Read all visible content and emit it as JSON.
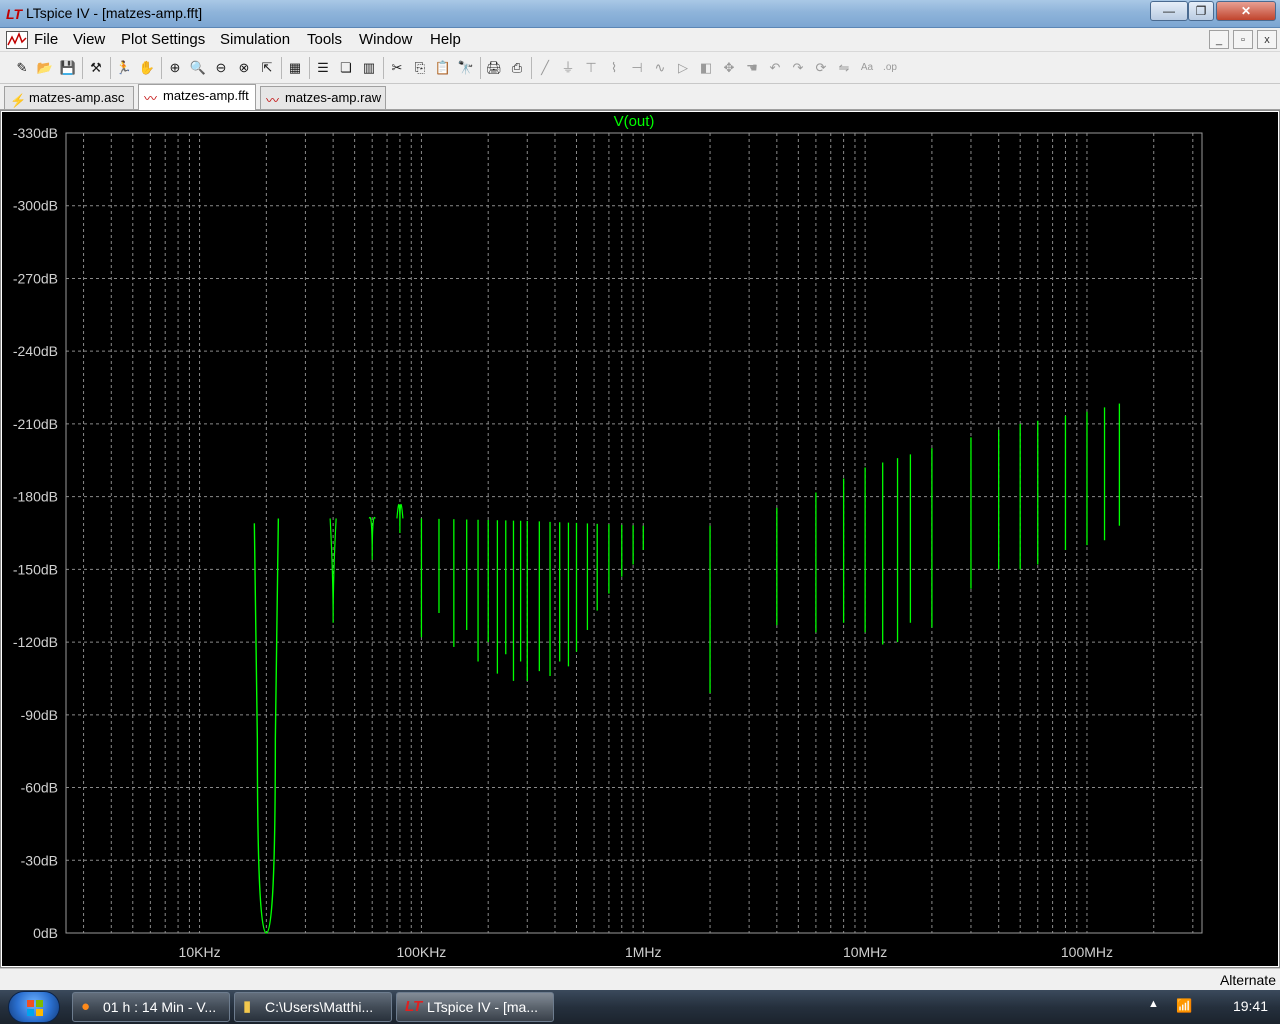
{
  "window": {
    "title": "LTspice IV - [matzes-amp.fft]",
    "logo_text": "LT",
    "minimize_glyph": "—",
    "maximize_glyph": "❐",
    "close_glyph": "✕"
  },
  "menu": {
    "items": [
      {
        "label": "File"
      },
      {
        "label": "View"
      },
      {
        "label": "Plot Settings"
      },
      {
        "label": "Simulation"
      },
      {
        "label": "Tools"
      },
      {
        "label": "Window"
      },
      {
        "label": "Help"
      }
    ],
    "mdi_minimize": "_",
    "mdi_restore": "▫",
    "mdi_close": "x"
  },
  "toolbar": {
    "icons": [
      "new-schematic-icon",
      "open-icon",
      "save-icon",
      "control-panel-icon",
      "run-icon",
      "pan-icon",
      "zoom-in-icon",
      "zoom-area-icon",
      "zoom-out-icon",
      "zoom-cancel-icon",
      "autorange-icon",
      "plot-settings-icon",
      "tile-horizontal-icon",
      "cascade-icon",
      "tile-vertical-icon",
      "cut-icon",
      "copy-icon",
      "paste-icon",
      "find-icon",
      "print-preview-icon",
      "print-icon",
      "wire-icon",
      "ground-icon",
      "label-icon",
      "resistor-icon",
      "capacitor-icon",
      "inductor-icon",
      "diode-icon",
      "component-icon",
      "move-icon",
      "drag-icon",
      "undo-icon",
      "redo-icon",
      "rotate-icon",
      "mirror-icon",
      "text-icon",
      "spice-directive-icon"
    ]
  },
  "tabs": [
    {
      "label": "matzes-amp.asc",
      "icon": "schematic-icon"
    },
    {
      "label": "matzes-amp.fft",
      "icon": "waveform-icon"
    },
    {
      "label": "matzes-amp.raw",
      "icon": "waveform-icon"
    }
  ],
  "chart_data": {
    "type": "line",
    "title": "V(out)",
    "trace_color": "#00ff00",
    "background_color": "#000000",
    "grid": true,
    "x_scale": "log",
    "xlim_hz": [
      2500,
      330000000
    ],
    "ylim_db": [
      -330,
      0
    ],
    "x_ticks": [
      {
        "value": 10000,
        "label": "10KHz"
      },
      {
        "value": 100000,
        "label": "100KHz"
      },
      {
        "value": 1000000,
        "label": "1MHz"
      },
      {
        "value": 10000000,
        "label": "10MHz"
      },
      {
        "value": 100000000,
        "label": "100MHz"
      }
    ],
    "y_ticks": [
      {
        "value": 0,
        "label": "0dB"
      },
      {
        "value": -30,
        "label": "-30dB"
      },
      {
        "value": -60,
        "label": "-60dB"
      },
      {
        "value": -90,
        "label": "-90dB"
      },
      {
        "value": -120,
        "label": "-120dB"
      },
      {
        "value": -150,
        "label": "-150dB"
      },
      {
        "value": -180,
        "label": "-180dB"
      },
      {
        "value": -210,
        "label": "-210dB"
      },
      {
        "value": -240,
        "label": "-240dB"
      },
      {
        "value": -270,
        "label": "-270dB"
      },
      {
        "value": -300,
        "label": "-300dB"
      },
      {
        "value": -330,
        "label": "-330dB"
      }
    ],
    "series": [
      {
        "name": "V(out)",
        "noise_floor": [
          [
            2500,
            -159
          ],
          [
            5000,
            -164
          ],
          [
            10000,
            -167
          ],
          [
            18000,
            -170
          ],
          [
            20000,
            -172
          ],
          [
            22000,
            -170
          ],
          [
            40000,
            -171
          ],
          [
            100000,
            -171
          ],
          [
            300000,
            -170
          ],
          [
            1000000,
            -168
          ],
          [
            2000000,
            -168
          ],
          [
            3000000,
            -172
          ],
          [
            5000000,
            -178
          ],
          [
            10000000,
            -192
          ],
          [
            20000000,
            -200
          ],
          [
            50000000,
            -210
          ],
          [
            100000000,
            -215
          ],
          [
            200000000,
            -222
          ],
          [
            320000000,
            -228
          ]
        ],
        "noise_spread": [
          [
            2500,
            0
          ],
          [
            80000,
            0
          ],
          [
            200000,
            4
          ],
          [
            600000,
            7
          ],
          [
            2000000,
            8
          ],
          [
            4000000,
            12
          ],
          [
            8000000,
            25
          ],
          [
            20000000,
            45
          ],
          [
            60000000,
            60
          ],
          [
            150000000,
            70
          ],
          [
            320000000,
            80
          ]
        ],
        "peaks": [
          {
            "f": 20000,
            "db": 0
          },
          {
            "f": 40000,
            "db": -128
          },
          {
            "f": 60000,
            "db": -154
          },
          {
            "f": 80000,
            "db": -165
          },
          {
            "f": 100000,
            "db": -122
          },
          {
            "f": 120000,
            "db": -132
          },
          {
            "f": 140000,
            "db": -118
          },
          {
            "f": 160000,
            "db": -125
          },
          {
            "f": 180000,
            "db": -112
          },
          {
            "f": 200000,
            "db": -120
          },
          {
            "f": 220000,
            "db": -107
          },
          {
            "f": 240000,
            "db": -115
          },
          {
            "f": 260000,
            "db": -104
          },
          {
            "f": 280000,
            "db": -112
          },
          {
            "f": 300000,
            "db": -104
          },
          {
            "f": 340000,
            "db": -108
          },
          {
            "f": 380000,
            "db": -106
          },
          {
            "f": 420000,
            "db": -112
          },
          {
            "f": 460000,
            "db": -110
          },
          {
            "f": 500000,
            "db": -116
          },
          {
            "f": 560000,
            "db": -125
          },
          {
            "f": 620000,
            "db": -133
          },
          {
            "f": 700000,
            "db": -140
          },
          {
            "f": 800000,
            "db": -147
          },
          {
            "f": 900000,
            "db": -152
          },
          {
            "f": 1000000,
            "db": -158
          },
          {
            "f": 2000000,
            "db": -99
          },
          {
            "f": 4000000,
            "db": -127
          },
          {
            "f": 6000000,
            "db": -124
          },
          {
            "f": 8000000,
            "db": -128
          },
          {
            "f": 10000000,
            "db": -124
          },
          {
            "f": 12000000,
            "db": -119
          },
          {
            "f": 14000000,
            "db": -120
          },
          {
            "f": 16000000,
            "db": -128
          },
          {
            "f": 20000000,
            "db": -126
          },
          {
            "f": 30000000,
            "db": -142
          },
          {
            "f": 40000000,
            "db": -150
          },
          {
            "f": 50000000,
            "db": -150
          },
          {
            "f": 60000000,
            "db": -152
          },
          {
            "f": 80000000,
            "db": -158
          },
          {
            "f": 100000000,
            "db": -160
          },
          {
            "f": 120000000,
            "db": -162
          },
          {
            "f": 140000000,
            "db": -168
          }
        ]
      }
    ]
  },
  "status": {
    "text": "Alternate"
  },
  "taskbar": {
    "items": [
      {
        "label": "01 h : 14 Min - V...",
        "icon": "firefox-icon",
        "active": false
      },
      {
        "label": "C:\\Users\\Matthi...",
        "icon": "folder-icon",
        "active": false
      },
      {
        "label": "LTspice IV - [ma...",
        "icon": "ltspice-icon",
        "active": true
      }
    ],
    "tray_arrow": "▲",
    "clock": "19:41"
  }
}
